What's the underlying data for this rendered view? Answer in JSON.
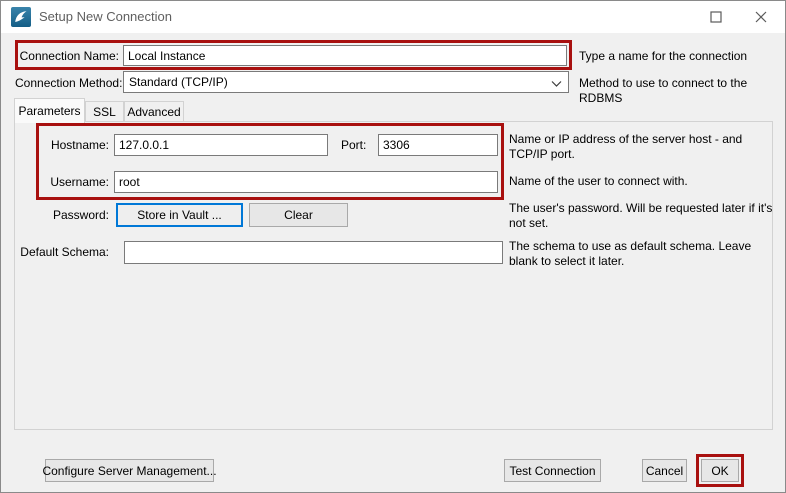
{
  "window": {
    "title": "Setup New Connection"
  },
  "header_fields": {
    "connection_name": {
      "label": "Connection Name:",
      "value": "Local Instance",
      "help": "Type a name for the connection"
    },
    "connection_method": {
      "label": "Connection Method:",
      "value": "Standard (TCP/IP)",
      "help": "Method to use to connect to the RDBMS"
    }
  },
  "tabs": {
    "parameters": "Parameters",
    "ssl": "SSL",
    "advanced": "Advanced"
  },
  "parameters": {
    "hostname": {
      "label": "Hostname:",
      "value": "127.0.0.1"
    },
    "port": {
      "label": "Port:",
      "value": "3306"
    },
    "hostname_help": "Name or IP address of the server host - and TCP/IP port.",
    "username": {
      "label": "Username:",
      "value": "root"
    },
    "username_help": "Name of the user to connect with.",
    "password": {
      "label": "Password:",
      "store_button": "Store in Vault ...",
      "clear_button": "Clear",
      "help": "The user's password. Will be requested later if it's not set."
    },
    "default_schema": {
      "label": "Default Schema:",
      "value": "",
      "help": "The schema to use as default schema. Leave blank to select it later."
    }
  },
  "footer": {
    "configure_button": "Configure Server Management...",
    "test_button": "Test Connection",
    "cancel_button": "Cancel",
    "ok_button": "OK"
  },
  "colors": {
    "highlight_red": "#a8100f",
    "focus_blue": "#0078d7",
    "icon_blue": "#1b6a96"
  }
}
